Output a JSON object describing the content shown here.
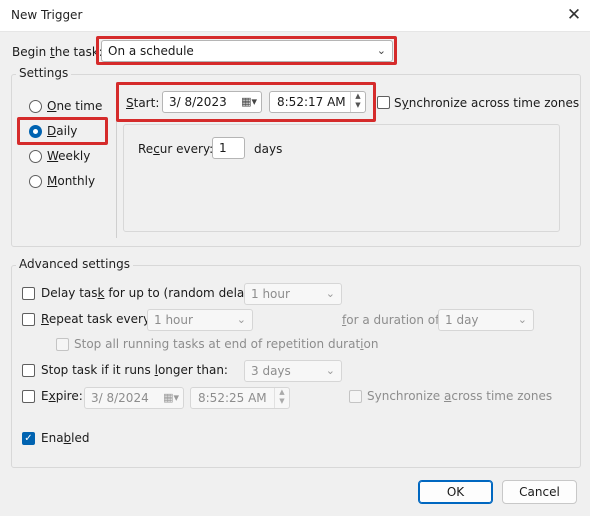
{
  "window": {
    "title": "New Trigger",
    "close_glyph": "✕"
  },
  "begin_task": {
    "label_pre": "Begin ",
    "label_u": "t",
    "label_post": "he task:",
    "value": "On a schedule"
  },
  "settings": {
    "title": "Settings",
    "options": [
      {
        "pre": "",
        "u": "O",
        "post": "ne time",
        "selected": false
      },
      {
        "pre": "",
        "u": "D",
        "post": "aily",
        "selected": true
      },
      {
        "pre": "",
        "u": "W",
        "post": "eekly",
        "selected": false
      },
      {
        "pre": "",
        "u": "M",
        "post": "onthly",
        "selected": false
      }
    ],
    "start_label_pre": "",
    "start_label_u": "S",
    "start_label_post": "tart:",
    "start_date": "3/  8/2023",
    "start_time": "8:52:17 AM",
    "sync_label_pre": "S",
    "sync_label_u": "y",
    "sync_label_post": "nchronize across time zones",
    "recur_pre": "Re",
    "recur_u": "c",
    "recur_post": "ur every:",
    "recur_value": "1",
    "recur_unit": "days"
  },
  "advanced": {
    "title": "Advanced settings",
    "delay_label_pre": "Delay tas",
    "delay_label_u": "k",
    "delay_label_post": " for up to (random delay):",
    "delay_value": "1 hour",
    "repeat_label_pre": "",
    "repeat_label_u": "R",
    "repeat_label_post": "epeat task every:",
    "repeat_value": "1 hour",
    "duration_label_pre": "",
    "duration_label_u": "f",
    "duration_label_post": "or a duration of:",
    "duration_value": "1 day",
    "stop_all_label_pre": "Stop all running tasks at end of repetition durat",
    "stop_all_label_u": "i",
    "stop_all_label_post": "on",
    "stop_long_label_pre": "Stop task if it runs ",
    "stop_long_label_u": "l",
    "stop_long_label_post": "onger than:",
    "stop_long_value": "3 days",
    "expire_label_pre": "E",
    "expire_label_u": "x",
    "expire_label_post": "pire:",
    "expire_date": "3/  8/2024",
    "expire_time": "8:52:25 AM",
    "expire_sync_pre": "Synchronize ",
    "expire_sync_u": "a",
    "expire_sync_post": "cross time zones",
    "enabled_pre": "Ena",
    "enabled_u": "b",
    "enabled_post": "led"
  },
  "buttons": {
    "ok": "OK",
    "cancel": "Cancel"
  },
  "colors": {
    "accent": "#0063b1",
    "highlight": "#d52b2b"
  }
}
